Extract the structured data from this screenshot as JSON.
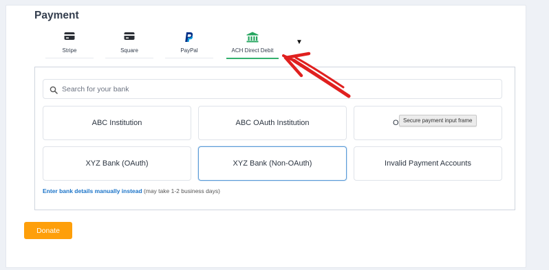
{
  "payment": {
    "heading": "Payment",
    "tabs": [
      {
        "label": "Stripe",
        "icon": "card-icon"
      },
      {
        "label": "Square",
        "icon": "card-icon"
      },
      {
        "label": "PayPal",
        "icon": "paypal-icon"
      },
      {
        "label": "ACH Direct Debit",
        "icon": "bank-icon",
        "active": true
      }
    ],
    "more_icon": "caret-down-icon",
    "active_color": "#33b06d"
  },
  "bank_selector": {
    "search_placeholder": "Search for your bank",
    "banks": [
      {
        "label": "ABC Institution"
      },
      {
        "label": "ABC OAuth Institution"
      },
      {
        "label": "O"
      },
      {
        "label": "XYZ Bank (OAuth)"
      },
      {
        "label": "XYZ Bank (Non-OAuth)",
        "selected": true
      },
      {
        "label": "Invalid Payment Accounts"
      }
    ],
    "tooltip": "Secure payment input frame",
    "manual_link": "Enter bank details manually instead",
    "manual_note": "(may take 1-2 business days)"
  },
  "donate_button": {
    "label": "Donate",
    "color": "#fe9f0a"
  },
  "annotation": {
    "color": "#e0201f",
    "icon": "red-arrow-annotation"
  }
}
